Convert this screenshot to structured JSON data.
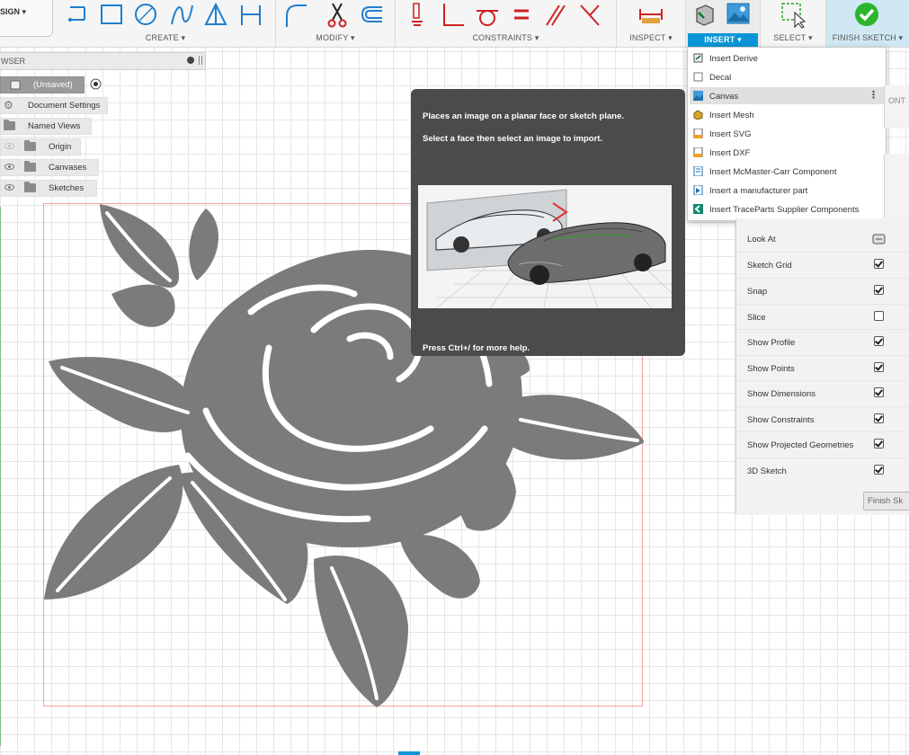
{
  "toolbar": {
    "design_label": "SIGN ▾",
    "groups": {
      "create": "CREATE ▾",
      "modify": "MODIFY ▾",
      "constraints": "CONSTRAINTS ▾",
      "inspect": "INSPECT ▾",
      "insert": "INSERT ▾",
      "select": "SELECT ▾",
      "finish": "FINISH SKETCH ▾"
    }
  },
  "browser": {
    "title": "WSER",
    "items": [
      {
        "label": "(Unsaved)"
      },
      {
        "label": "Document Settings"
      },
      {
        "label": "Named Views"
      },
      {
        "label": "Origin"
      },
      {
        "label": "Canvases"
      },
      {
        "label": "Sketches"
      }
    ]
  },
  "insert_menu": {
    "items": [
      {
        "label": "Insert Derive",
        "icon": "derive-icon"
      },
      {
        "label": "Decal",
        "icon": "decal-icon"
      },
      {
        "label": "Canvas",
        "icon": "canvas-icon"
      },
      {
        "label": "Insert Mesh",
        "icon": "mesh-icon"
      },
      {
        "label": "Insert SVG",
        "icon": "svg-icon"
      },
      {
        "label": "Insert DXF",
        "icon": "dxf-icon"
      },
      {
        "label": "Insert McMaster-Carr Component",
        "icon": "mcmaster-icon"
      },
      {
        "label": "Insert a manufacturer part",
        "icon": "manufacturer-icon"
      },
      {
        "label": "Insert TraceParts Supplier Components",
        "icon": "traceparts-icon"
      }
    ],
    "highlighted": "Canvas"
  },
  "tooltip": {
    "line1": "Places an image on a planar face or sketch plane.",
    "line2": "Select a face then select an image to import.",
    "help": "Press Ctrl+/ for more help."
  },
  "sketch_palette": {
    "options": [
      {
        "label": "Look At",
        "type": "button"
      },
      {
        "label": "Sketch Grid",
        "checked": true
      },
      {
        "label": "Snap",
        "checked": true
      },
      {
        "label": "Slice",
        "checked": false
      },
      {
        "label": "Show Profile",
        "checked": true
      },
      {
        "label": "Show Points",
        "checked": true
      },
      {
        "label": "Show Dimensions",
        "checked": true
      },
      {
        "label": "Show Constraints",
        "checked": true
      },
      {
        "label": "Show Projected Geometries",
        "checked": true
      },
      {
        "label": "3D Sketch",
        "checked": true
      }
    ],
    "finish_button": "Finish Sk",
    "behind_text": "ONT"
  },
  "colors": {
    "accent": "#0696d7",
    "finish_green": "#2cb52c",
    "tooltip_bg": "#4b4b4b",
    "rose_gray": "#7b7b7b",
    "canvas_frame": "#f0a0a0"
  }
}
